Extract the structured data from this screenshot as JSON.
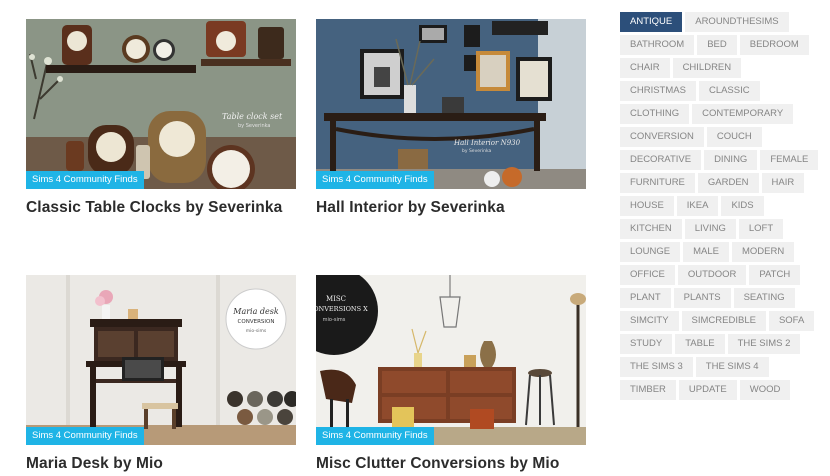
{
  "posts": [
    {
      "title": "Classic Table Clocks by Severinka",
      "badge": "Sims 4 Community Finds",
      "overlay": "Table clock set",
      "overlay_sub": "by Severinka"
    },
    {
      "title": "Hall Interior by Severinka",
      "badge": "Sims 4 Community Finds",
      "overlay": "Hall Interior N930",
      "overlay_sub": "by Severinka"
    },
    {
      "title": "Maria Desk by Mio",
      "badge": "Sims 4 Community Finds",
      "overlay": "Maria desk",
      "overlay_2": "CONVERSION",
      "overlay_sub": "mio-sims"
    },
    {
      "title": "Misc Clutter Conversions by Mio",
      "badge": "Sims 4 Community Finds",
      "overlay": "MISC",
      "overlay_2": "CONVERSIONS X",
      "overlay_sub": "mio-sims"
    }
  ],
  "tags": [
    {
      "label": "ANTIQUE",
      "active": true
    },
    {
      "label": "AROUNDTHESIMS"
    },
    {
      "label": "BATHROOM"
    },
    {
      "label": "BED"
    },
    {
      "label": "BEDROOM"
    },
    {
      "label": "CHAIR"
    },
    {
      "label": "CHILDREN"
    },
    {
      "label": "CHRISTMAS"
    },
    {
      "label": "CLASSIC"
    },
    {
      "label": "CLOTHING"
    },
    {
      "label": "CONTEMPORARY"
    },
    {
      "label": "CONVERSION"
    },
    {
      "label": "COUCH"
    },
    {
      "label": "DECORATIVE"
    },
    {
      "label": "DINING"
    },
    {
      "label": "FEMALE"
    },
    {
      "label": "FURNITURE"
    },
    {
      "label": "GARDEN"
    },
    {
      "label": "HAIR"
    },
    {
      "label": "HOUSE"
    },
    {
      "label": "IKEA"
    },
    {
      "label": "KIDS"
    },
    {
      "label": "KITCHEN"
    },
    {
      "label": "LIVING"
    },
    {
      "label": "LOFT"
    },
    {
      "label": "LOUNGE"
    },
    {
      "label": "MALE"
    },
    {
      "label": "MODERN"
    },
    {
      "label": "OFFICE"
    },
    {
      "label": "OUTDOOR"
    },
    {
      "label": "PATCH"
    },
    {
      "label": "PLANT"
    },
    {
      "label": "PLANTS"
    },
    {
      "label": "SEATING"
    },
    {
      "label": "SIMCITY"
    },
    {
      "label": "SIMCREDIBLE"
    },
    {
      "label": "SOFA"
    },
    {
      "label": "STUDY"
    },
    {
      "label": "TABLE"
    },
    {
      "label": "THE SIMS 2"
    },
    {
      "label": "THE SIMS 3"
    },
    {
      "label": "THE SIMS 4"
    },
    {
      "label": "TIMBER"
    },
    {
      "label": "UPDATE"
    },
    {
      "label": "WOOD"
    }
  ]
}
